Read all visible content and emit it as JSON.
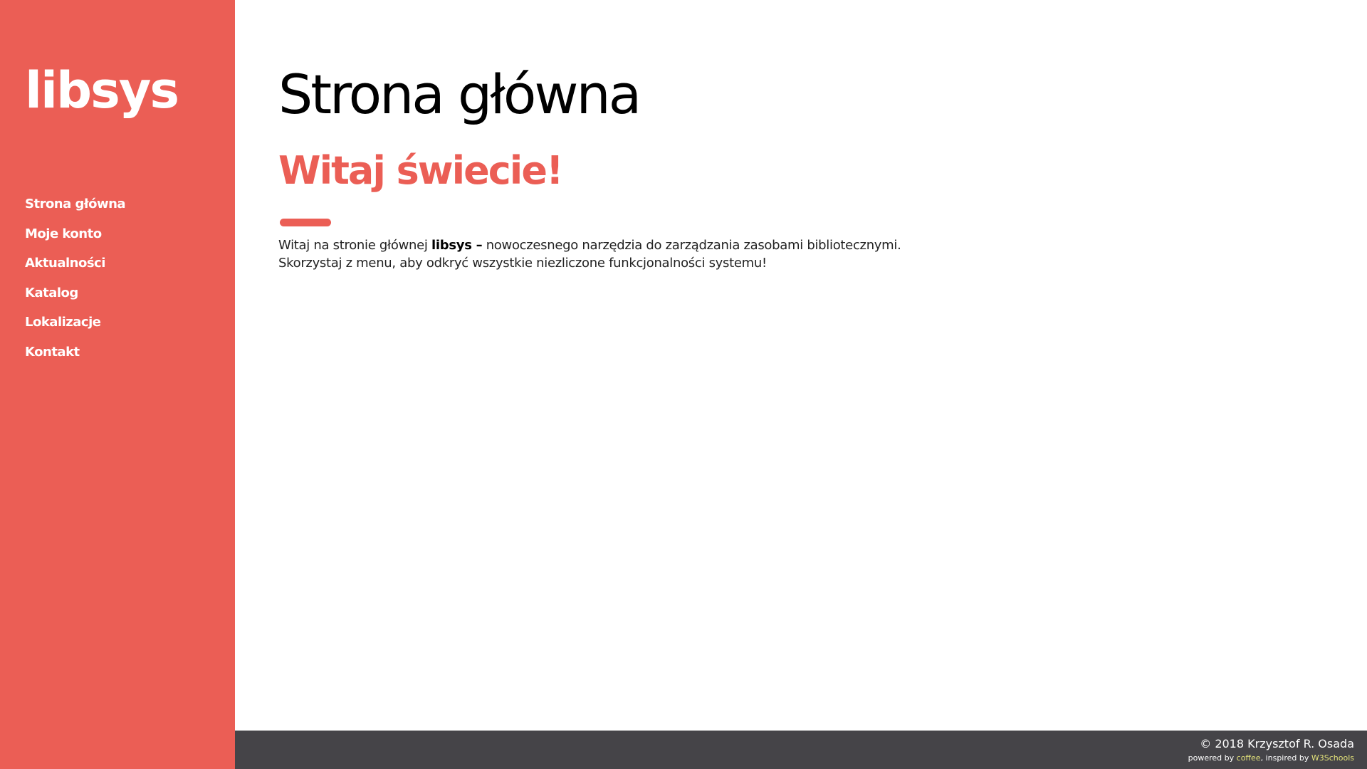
{
  "app": {
    "logo": "libsys"
  },
  "sidebar": {
    "items": [
      {
        "label": "Strona główna"
      },
      {
        "label": "Moje konto"
      },
      {
        "label": "Aktualności"
      },
      {
        "label": "Katalog"
      },
      {
        "label": "Lokalizacje"
      },
      {
        "label": "Kontakt"
      }
    ]
  },
  "main": {
    "title": "Strona główna",
    "welcome": "Witaj świecie!",
    "intro": {
      "before": "Witaj na stronie głównej ",
      "brand": "libsys –",
      "after": " nowoczesnego narzędzia do zarządzania zasobami bibliotecznymi.",
      "line2": "Skorzystaj z menu, aby odkryć wszystkie niezliczone funkcjonalności systemu!"
    }
  },
  "footer": {
    "copyright": "© 2018 Krzysztof R. Osada",
    "powered_by": "powered by ",
    "coffee": "coffee",
    "inspired_by": ", inspired by ",
    "w3schools": "W3Schools"
  },
  "colors": {
    "accent": "#eb5e55",
    "footer_bg": "#454448",
    "link": "#e4e37a"
  }
}
